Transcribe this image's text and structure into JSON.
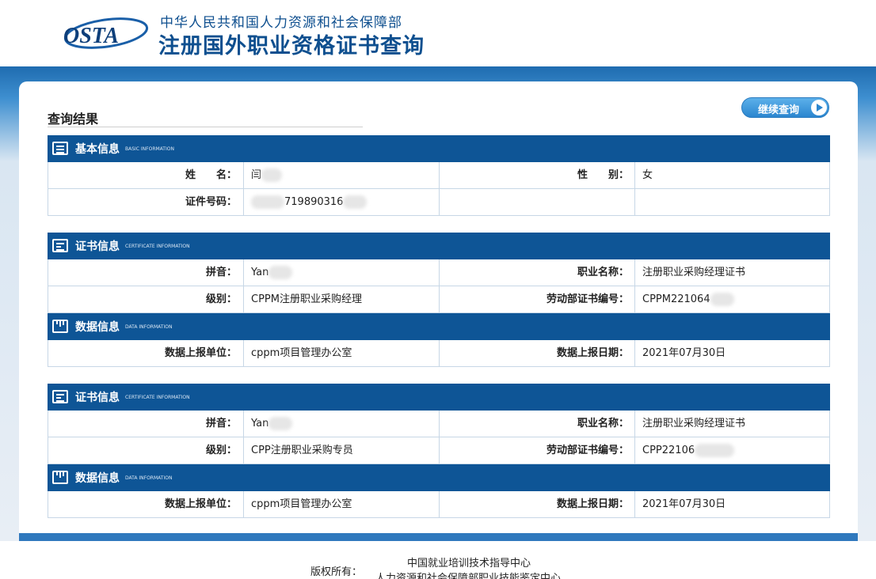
{
  "header": {
    "logo_text": "OSTA",
    "ministry": "中华人民共和国人力资源和社会保障部",
    "system_title": "注册国外职业资格证书查询"
  },
  "page": {
    "result_title": "查询结果",
    "continue_button": "继续查询"
  },
  "basic": {
    "title": "基本信息",
    "subtitle": "BASIC INFORMATION",
    "name_label": "姓　　名：",
    "name_value": "闫",
    "gender_label": "性　　别：",
    "gender_value": "女",
    "id_label": "证件号码：",
    "id_value": "719890316"
  },
  "certificates": [
    {
      "title": "证书信息",
      "subtitle": "CERTIFICATE INFORMATION",
      "pinyin_label": "拼音：",
      "pinyin_value": "Yan",
      "job_label": "职业名称：",
      "job_value": "注册职业采购经理证书",
      "level_label": "级别：",
      "level_value": "CPPM注册职业采购经理",
      "cert_no_label": "劳动部证书编号：",
      "cert_no_value": "CPPM221064",
      "data_title": "数据信息",
      "data_subtitle": "DATA INFORMATION",
      "unit_label": "数据上报单位：",
      "unit_value": "cppm项目管理办公室",
      "date_label": "数据上报日期：",
      "date_value": "2021年07月30日"
    },
    {
      "title": "证书信息",
      "subtitle": "CERTIFICATE INFORMATION",
      "pinyin_label": "拼音：",
      "pinyin_value": "Yan",
      "job_label": "职业名称：",
      "job_value": "注册职业采购经理证书",
      "level_label": "级别：",
      "level_value": "CPP注册职业采购专员",
      "cert_no_label": "劳动部证书编号：",
      "cert_no_value": "CPP22106",
      "data_title": "数据信息",
      "data_subtitle": "DATA INFORMATION",
      "unit_label": "数据上报单位：",
      "unit_value": "cppm项目管理办公室",
      "date_label": "数据上报日期：",
      "date_value": "2021年07月30日"
    }
  ],
  "footer": {
    "copyright_label": "版权所有：",
    "org1": "中国就业培训技术指导中心",
    "org2": "人力资源和社会保障部职业技能鉴定中心"
  },
  "colors": {
    "section_bar": "#0e5596",
    "title_blue": "#0e4f8f",
    "button_blue": "#2b86cf"
  }
}
